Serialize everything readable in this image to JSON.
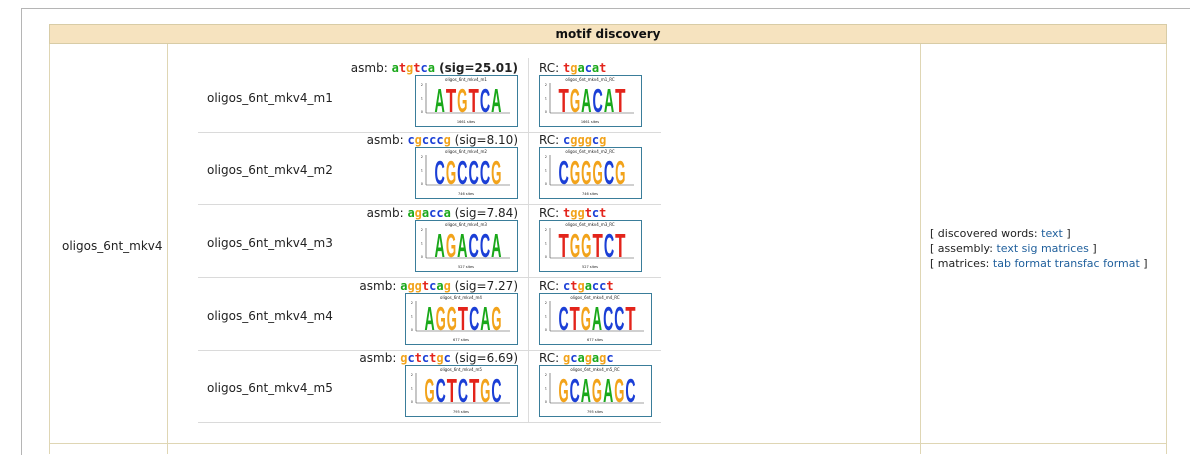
{
  "section": {
    "title": "motif discovery"
  },
  "group": {
    "name": "oligos_6nt_mkv4"
  },
  "rows": [
    {
      "name": "oligos_6nt_mkv4_m1",
      "asmb_prefix": "asmb: ",
      "asmb_seq": "atgtca",
      "sig": "(sig=25.01)",
      "sig_bold": true,
      "rc_prefix": "RC: ",
      "rc_seq": "tgacat",
      "logo_title": "oligos_6nt_mkv4_m1",
      "rc_logo_title": "oligos_6nt_mkv4_m1_RC",
      "sites": "1661 sites",
      "rc_sites": "1661 sites",
      "logo_letters": "ATGTCA",
      "rc_logo_letters": "TGACAT"
    },
    {
      "name": "oligos_6nt_mkv4_m2",
      "asmb_prefix": "asmb: ",
      "asmb_seq": "cgcccg",
      "sig": "(sig=8.10)",
      "sig_bold": false,
      "rc_prefix": "RC: ",
      "rc_seq": "cgggcg",
      "logo_title": "oligos_6nt_mkv4_m2",
      "rc_logo_title": "oligos_6nt_mkv4_m2_RC",
      "sites": "746 sites",
      "rc_sites": "746 sites",
      "logo_letters": "CGCCCG",
      "rc_logo_letters": "CGGGCG"
    },
    {
      "name": "oligos_6nt_mkv4_m3",
      "asmb_prefix": "asmb: ",
      "asmb_seq": "agacca",
      "sig": "(sig=7.84)",
      "sig_bold": false,
      "rc_prefix": "RC: ",
      "rc_seq": "tggtct",
      "logo_title": "oligos_6nt_mkv4_m3",
      "rc_logo_title": "oligos_6nt_mkv4_m3_RC",
      "sites": "527 sites",
      "rc_sites": "527 sites",
      "logo_letters": "AGACCA",
      "rc_logo_letters": "TGGTCT"
    },
    {
      "name": "oligos_6nt_mkv4_m4",
      "asmb_prefix": "asmb: ",
      "asmb_seq": "aggtcag",
      "sig": "(sig=7.27)",
      "sig_bold": false,
      "rc_prefix": "RC: ",
      "rc_seq": "ctgacct",
      "logo_title": "oligos_6nt_mkv4_m4",
      "rc_logo_title": "oligos_6nt_mkv4_m4_RC",
      "sites": "677 sites",
      "rc_sites": "677 sites",
      "logo_letters": "AGGTCAG",
      "rc_logo_letters": "CTGACCT"
    },
    {
      "name": "oligos_6nt_mkv4_m5",
      "asmb_prefix": "asmb: ",
      "asmb_seq": "gctctgc",
      "sig": "(sig=6.69)",
      "sig_bold": false,
      "rc_prefix": "RC: ",
      "rc_seq": "gcagagc",
      "logo_title": "oligos_6nt_mkv4_m5",
      "rc_logo_title": "oligos_6nt_mkv4_m5_RC",
      "sites": "795 sites",
      "rc_sites": "795 sites",
      "logo_letters": "GCTCTGC",
      "rc_logo_letters": "GCAGAGC"
    }
  ],
  "links": {
    "words_prefix": "[ discovered words: ",
    "words_text": "text",
    "words_suffix": " ]",
    "assembly_prefix": "[ assembly: ",
    "assembly_text": "text",
    "assembly_sig": "sig",
    "assembly_matrices": "matrices",
    "assembly_suffix": " ]",
    "matrices_prefix": "[ matrices: ",
    "matrices_tab": "tab",
    "matrices_format": "format",
    "matrices_transfac": "transfac",
    "matrices_format2": "format",
    "matrices_suffix": " ]"
  },
  "colors": {
    "a": "#1aa81a",
    "c": "#1b3fd6",
    "g": "#f2a31b",
    "t": "#e3241b",
    "header_bg": "#f6e3bf",
    "logo_border": "#3a7d9a",
    "link": "#1f5f9c"
  }
}
